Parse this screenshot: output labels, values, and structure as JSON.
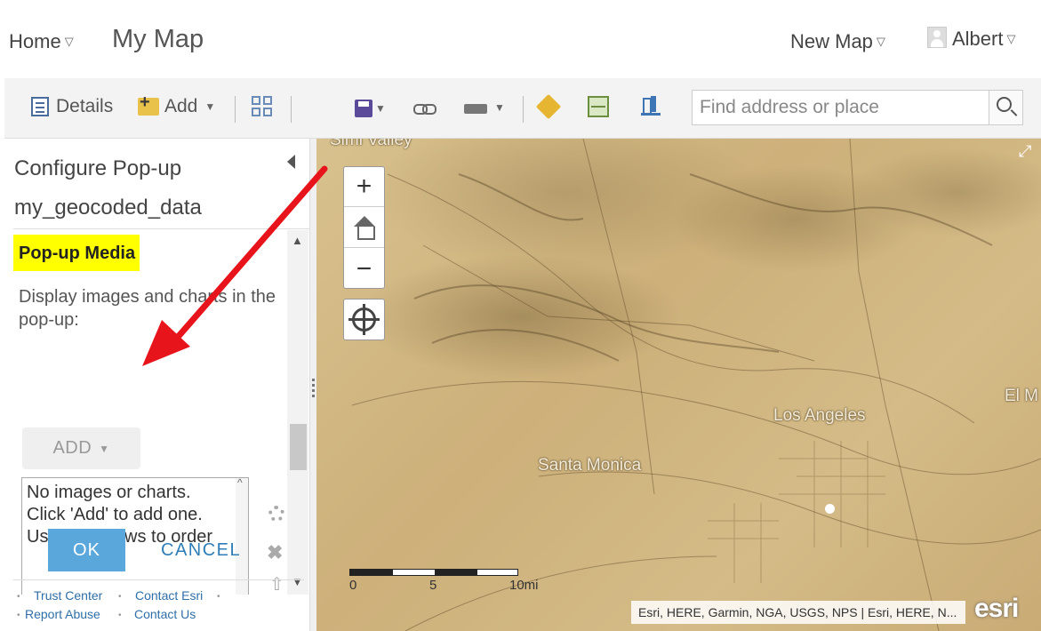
{
  "header": {
    "home_label": "Home",
    "map_title": "My Map",
    "new_map_label": "New Map",
    "user_name": "Albert"
  },
  "toolbar": {
    "details_label": "Details",
    "add_label": "Add",
    "search_placeholder": "Find address or place"
  },
  "panel": {
    "title": "Configure Pop-up",
    "layer_name": "my_geocoded_data",
    "section_label": "Pop-up Media",
    "section_desc": "Display images and charts in the pop-up:",
    "add_button": "ADD",
    "media_list_lines": [
      "No images or charts.",
      "Click 'Add' to add one.",
      "Use the arrows to order"
    ],
    "ok_label": "OK",
    "cancel_label": "CANCEL"
  },
  "footer": {
    "trust_center": "Trust Center",
    "contact_esri": "Contact Esri",
    "report_abuse": "Report Abuse",
    "contact_us": "Contact Us"
  },
  "map": {
    "places": {
      "simi_valley": "Simi Valley",
      "los_angeles": "Los Angeles",
      "santa_monica": "Santa Monica",
      "el_monte": "El M"
    },
    "scale": {
      "zero": "0",
      "five": "5",
      "ten": "10mi"
    },
    "attribution": "Esri, HERE, Garmin, NGA, USGS, NPS | Esri, HERE, N...",
    "logo": "esri"
  },
  "colors": {
    "accent_blue": "#5aa8db",
    "highlight_yellow": "#ffff00",
    "annotation_red": "#e8141b"
  }
}
